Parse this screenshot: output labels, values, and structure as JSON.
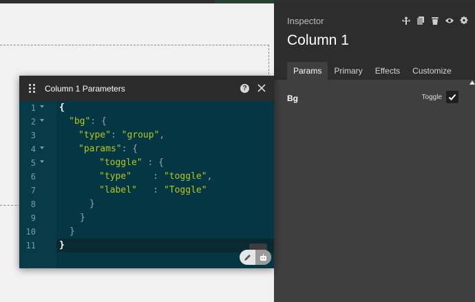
{
  "inspector": {
    "title": "Inspector",
    "heading": "Column 1",
    "toolbar_icons": [
      "move-icon",
      "duplicate-icon",
      "delete-icon",
      "visibility-icon",
      "settings-icon"
    ],
    "tabs": [
      {
        "label": "Params",
        "active": true
      },
      {
        "label": "Primary",
        "active": false
      },
      {
        "label": "Effects",
        "active": false
      },
      {
        "label": "Customize",
        "active": false
      }
    ],
    "field": {
      "label": "Bg",
      "toggle_label": "Toggle",
      "checked": true
    }
  },
  "dialog": {
    "title": "Column 1 Parameters",
    "help_glyph": "?",
    "line_numbers": [
      "1",
      "2",
      "3",
      "4",
      "5",
      "6",
      "7",
      "8",
      "9",
      "10",
      "11"
    ],
    "code": {
      "l1": "{",
      "l2_key": "\"bg\"",
      "l2_rest": ": {",
      "l3_key": "\"type\"",
      "l3_sep": ": ",
      "l3_val": "\"group\"",
      "l3_end": ",",
      "l4_key": "\"params\"",
      "l4_rest": ": {",
      "l5_key": "\"toggle\"",
      "l5_rest": " : {",
      "l6_key": "\"type\"",
      "l6_sep": "    : ",
      "l6_val": "\"toggle\"",
      "l6_end": ",",
      "l7_key": "\"label\"",
      "l7_sep": "   : ",
      "l7_val": "\"Toggle\"",
      "l8": "}",
      "l9": "}",
      "l10": "}",
      "l11": "}"
    }
  },
  "colors": {
    "editor_bg": "#053643",
    "syntax_string": "#b3c91f",
    "inspector_bg": "#2d2d2d",
    "panel_bg": "#3f3f3f"
  }
}
